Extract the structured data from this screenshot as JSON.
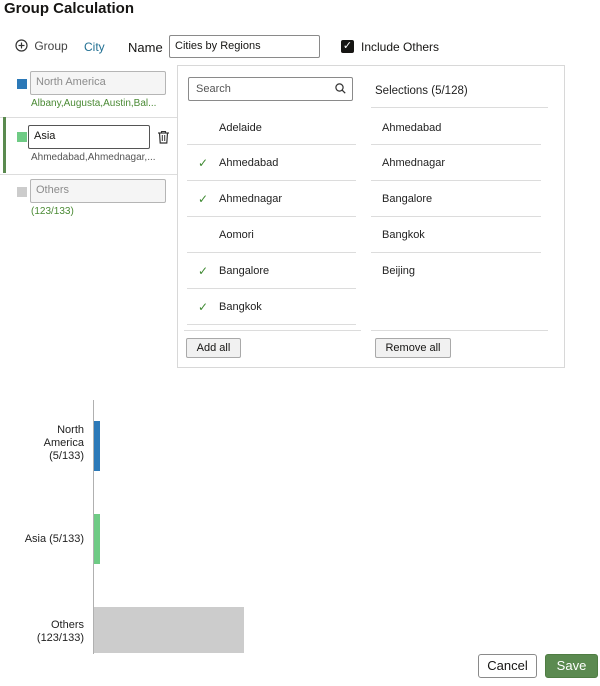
{
  "dialog": {
    "title": "Group Calculation"
  },
  "toolbar": {
    "add_group_label": "Group",
    "city_label": "City",
    "name_label": "Name",
    "name_value": "Cities by Regions",
    "include_others_label": "Include Others",
    "include_others_checked": true
  },
  "groups": [
    {
      "name": "North America",
      "members": "Albany,Augusta,Austin,Bal...",
      "color": "#2c79b8"
    },
    {
      "name": "Asia",
      "members": "Ahmedabad,Ahmednagar,...",
      "color": "#6fcb85"
    },
    {
      "name": "Others",
      "members": "(123/133)",
      "color": "#cccccc"
    }
  ],
  "picker": {
    "search_placeholder": "Search",
    "available": [
      {
        "label": "Adelaide",
        "checked": false
      },
      {
        "label": "Ahmedabad",
        "checked": true
      },
      {
        "label": "Ahmednagar",
        "checked": true
      },
      {
        "label": "Aomori",
        "checked": false
      },
      {
        "label": "Bangalore",
        "checked": true
      },
      {
        "label": "Bangkok",
        "checked": true
      }
    ],
    "check_glyph": "✓",
    "selections_header": "Selections (5/128)",
    "selections": [
      "Ahmedabad",
      "Ahmednagar",
      "Bangalore",
      "Bangkok",
      "Beijing"
    ],
    "add_all_label": "Add all",
    "remove_all_label": "Remove all"
  },
  "chart_data": {
    "type": "bar",
    "orientation": "horizontal",
    "categories": [
      "North America (5/133)",
      "Asia (5/133)",
      "Others (123/133)"
    ],
    "labels_display": [
      [
        "North",
        "America",
        "(5/133)"
      ],
      [
        "Asia (5/133)"
      ],
      [
        "Others",
        "(123/133)"
      ]
    ],
    "values": [
      5,
      5,
      123
    ],
    "colors": [
      "#2c79b8",
      "#6fcb85",
      "#cccccc"
    ],
    "xlim": [
      0,
      133
    ],
    "grid": false
  },
  "footer": {
    "cancel_label": "Cancel",
    "save_label": "Save"
  }
}
